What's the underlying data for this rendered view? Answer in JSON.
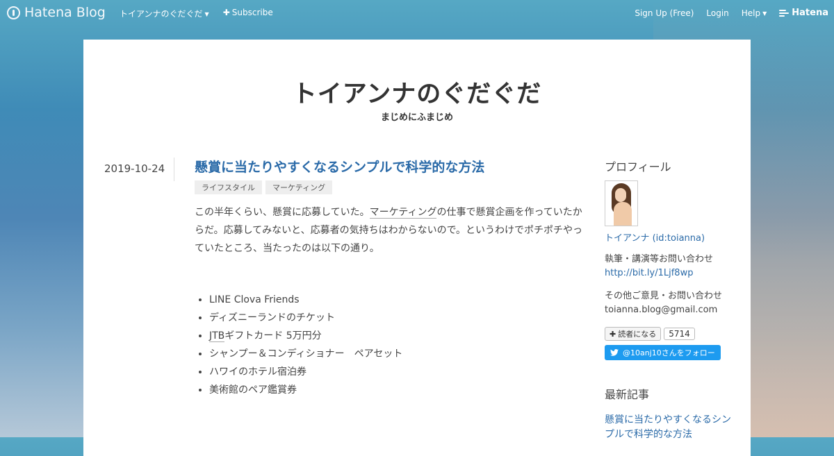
{
  "topbar": {
    "brand": "Hatena Blog",
    "blog_menu": "トイアンナのぐだぐだ",
    "subscribe": "Subscribe",
    "signup": "Sign Up (Free)",
    "login": "Login",
    "help": "Help",
    "hatena": "Hatena"
  },
  "blog": {
    "title": "トイアンナのぐだぐだ",
    "subtitle": "まじめにふまじめ"
  },
  "post": {
    "date": "2019-10-24",
    "title": "懸賞に当たりやすくなるシンプルで科学的な方法",
    "tags": [
      "ライフスタイル",
      "マーケティング"
    ],
    "intro_a": "この半年くらい、懸賞に応募していた。",
    "intro_kw": "マーケティング",
    "intro_b": "の仕事で懸賞企画を作っていたからだ。応募してみないと、応募者の気持ちはわからないので。というわけでポチポチやっていたところ、当たったのは以下の通り。",
    "prizes": [
      "LINE Clova Friends",
      "ディズニーランドのチケット",
      "ギフトカード 5万円分",
      "シャンプー＆コンディショナー　ペアセット",
      "ハワイのホテル宿泊券",
      "美術館のペア鑑賞券"
    ],
    "prize_kw": "JTB"
  },
  "sidebar": {
    "profile_heading": "プロフィール",
    "profile_name": "トイアンナ (id:toianna)",
    "contact1_label": "執筆・講演等お問い合わせ",
    "contact1_link": "http://bit.ly/1Ljf8wp",
    "contact2_label": "その他ご意見・お問い合わせ",
    "contact2_email": "toianna.blog@gmail.com",
    "reader_button": "読者になる",
    "reader_count": "5714",
    "twitter_follow": "@10anj10さんをフォロー",
    "recent_heading": "最新記事",
    "recent_item": "懸賞に当たりやすくなるシンプルで科学的な方法"
  },
  "colors": {
    "link": "#2a6aa8",
    "twitter": "#1d9bf0"
  }
}
